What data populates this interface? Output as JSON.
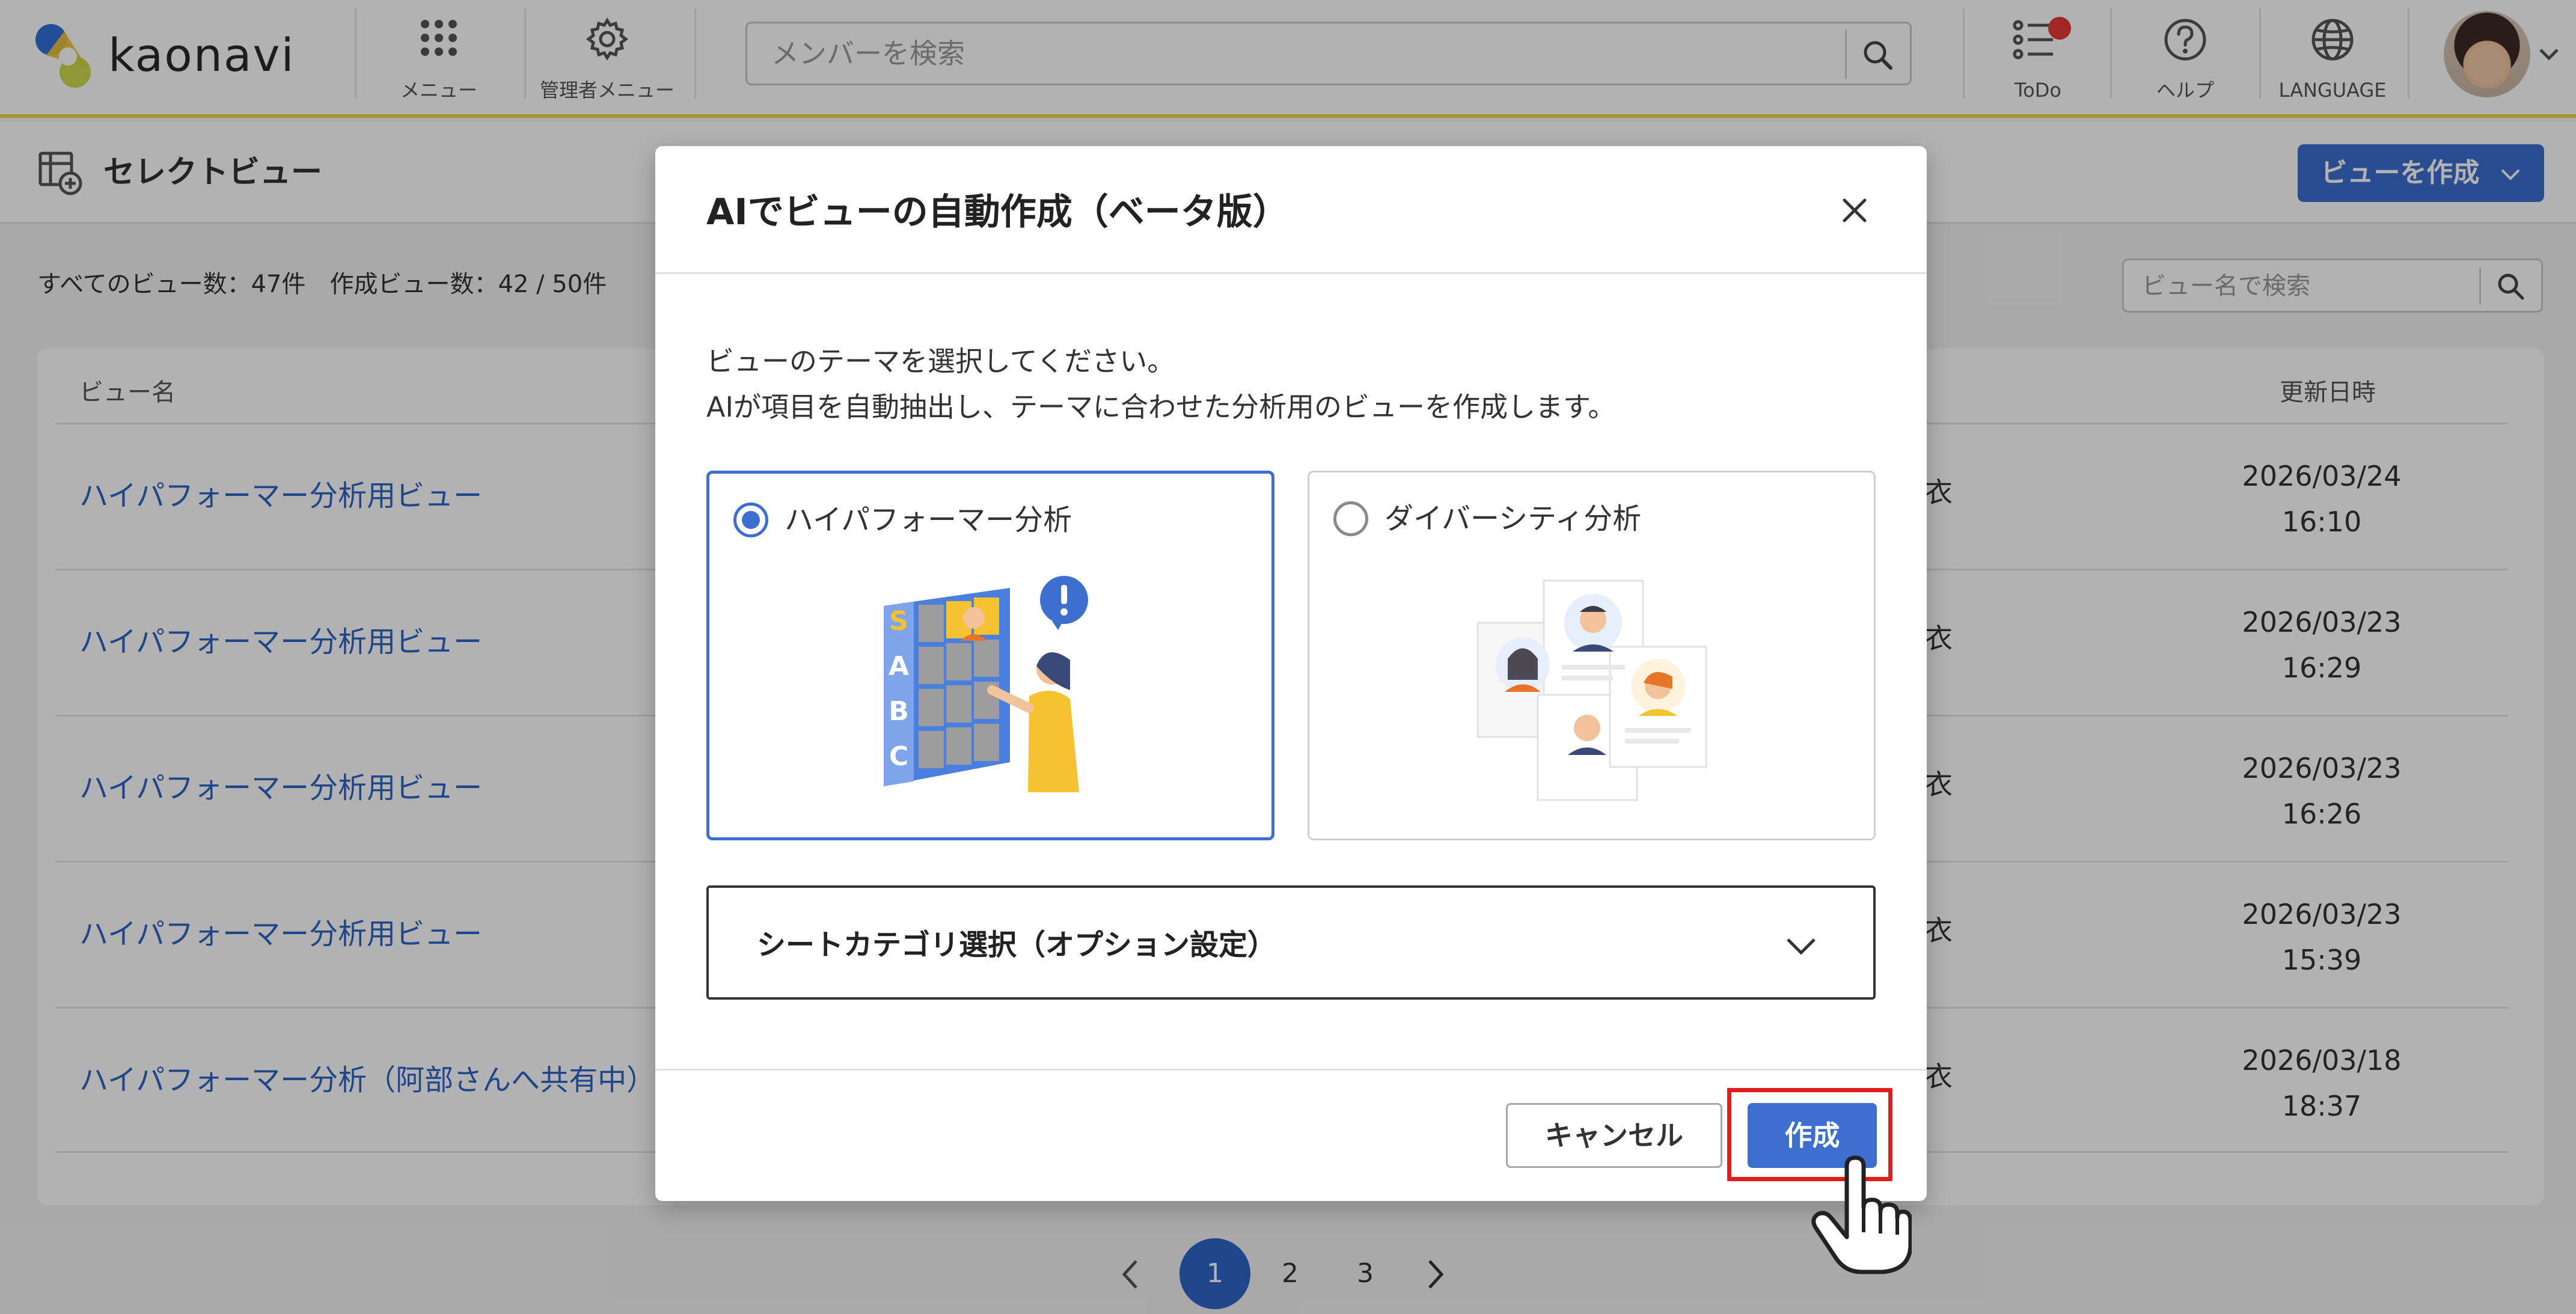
{
  "app": {
    "brand": "kaonavi"
  },
  "header": {
    "menu_label": "メニュー",
    "admin_menu_label": "管理者メニュー",
    "search_placeholder": "メンバーを検索",
    "todo_label": "ToDo",
    "help_label": "ヘルプ",
    "language_label": "LANGUAGE"
  },
  "page": {
    "title": "セレクトビュー",
    "create_view_button": "ビューを作成",
    "total_views": "すべてのビュー数：47件",
    "created_views": "作成ビュー数：42 / 50件",
    "view_search_placeholder": "ビュー名で検索"
  },
  "table": {
    "columns": {
      "name": "ビュー名",
      "updated": "更新日時"
    },
    "rows": [
      {
        "name": "ハイパフォーマー分析用ビュー",
        "owner": "衣",
        "date": "2026/03/24",
        "time": "16:10"
      },
      {
        "name": "ハイパフォーマー分析用ビュー",
        "owner": "衣",
        "date": "2026/03/23",
        "time": "16:29"
      },
      {
        "name": "ハイパフォーマー分析用ビュー",
        "owner": "衣",
        "date": "2026/03/23",
        "time": "16:26"
      },
      {
        "name": "ハイパフォーマー分析用ビュー",
        "owner": "衣",
        "date": "2026/03/23",
        "time": "15:39"
      },
      {
        "name": "ハイパフォーマー分析（阿部さんへ共有中）",
        "owner": "衣",
        "date": "2026/03/18",
        "time": "18:37"
      }
    ]
  },
  "pagination": {
    "pages": [
      "1",
      "2",
      "3"
    ],
    "current": "1"
  },
  "modal": {
    "title": "AIでビューの自動作成（ベータ版）",
    "description_line1": "ビューのテーマを選択してください。",
    "description_line2": "AIが項目を自動抽出し、テーマに合わせた分析用のビューを作成します。",
    "options": [
      {
        "label": "ハイパフォーマー分析",
        "selected": true
      },
      {
        "label": "ダイバーシティ分析",
        "selected": false
      }
    ],
    "rank_letters": [
      "S",
      "A",
      "B",
      "C"
    ],
    "accordion_label": "シートカテゴリ選択（オプション設定）",
    "cancel_button": "キャンセル",
    "create_button": "作成"
  },
  "colors": {
    "accent": "#3d6fd1",
    "link": "#2d64c8",
    "header_border": "#f2d24a",
    "highlight": "#e21b1b",
    "notification": "#e53935"
  }
}
